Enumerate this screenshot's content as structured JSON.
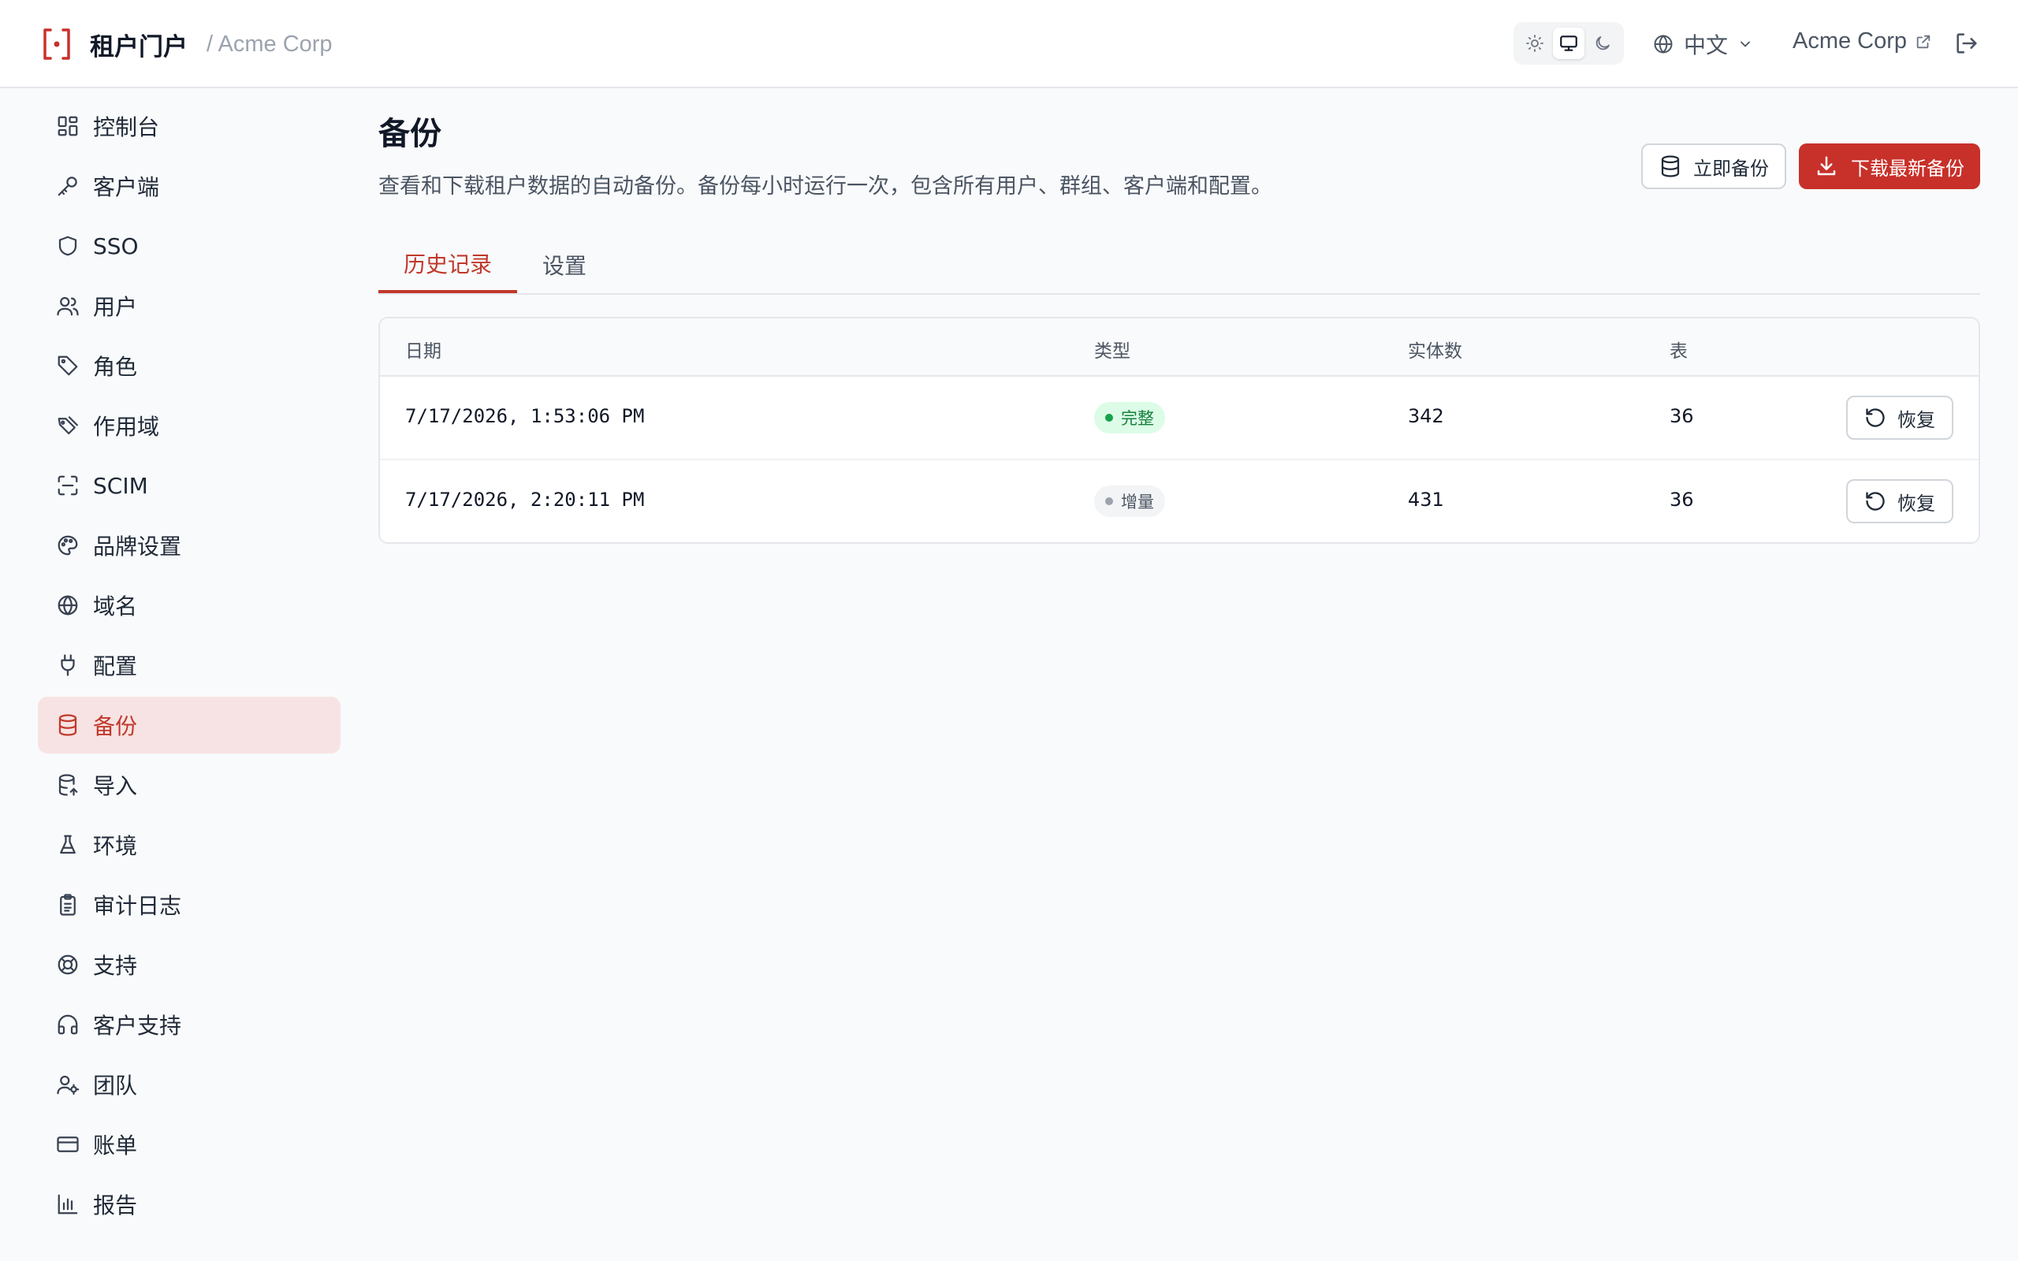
{
  "header": {
    "app_name": "租户门户",
    "tenant_breadcrumb": "/ Acme Corp",
    "language": "中文",
    "tenant_name": "Acme Corp",
    "theme_options": [
      "light",
      "system",
      "dark"
    ],
    "theme_selected": "system"
  },
  "sidebar": {
    "items": [
      {
        "label": "控制台",
        "icon": "dashboard-icon"
      },
      {
        "label": "客户端",
        "icon": "key-icon"
      },
      {
        "label": "SSO",
        "icon": "shield-icon"
      },
      {
        "label": "用户",
        "icon": "users-icon"
      },
      {
        "label": "角色",
        "icon": "tag-icon"
      },
      {
        "label": "作用域",
        "icon": "tags-icon"
      },
      {
        "label": "SCIM",
        "icon": "scan-icon"
      },
      {
        "label": "品牌设置",
        "icon": "palette-icon"
      },
      {
        "label": "域名",
        "icon": "globe-icon"
      },
      {
        "label": "配置",
        "icon": "plug-icon"
      },
      {
        "label": "备份",
        "icon": "database-icon",
        "active": true
      },
      {
        "label": "导入",
        "icon": "database-import-icon"
      },
      {
        "label": "环境",
        "icon": "flask-icon"
      },
      {
        "label": "审计日志",
        "icon": "clipboard-icon"
      },
      {
        "label": "支持",
        "icon": "lifebuoy-icon"
      },
      {
        "label": "客户支持",
        "icon": "headphones-icon"
      },
      {
        "label": "团队",
        "icon": "user-cog-icon"
      },
      {
        "label": "账单",
        "icon": "credit-card-icon"
      },
      {
        "label": "报告",
        "icon": "bar-chart-icon"
      }
    ]
  },
  "main": {
    "title": "备份",
    "description": "查看和下载租户数据的自动备份。备份每小时运行一次，包含所有用户、群组、客户端和配置。",
    "backup_now_label": "立即备份",
    "download_latest_label": "下载最新备份",
    "tabs": [
      {
        "label": "历史记录",
        "active": true
      },
      {
        "label": "设置",
        "active": false
      }
    ],
    "table": {
      "headers": [
        "日期",
        "类型",
        "实体数",
        "表"
      ],
      "rows": [
        {
          "date": "7/17/2026, 1:53:06 PM",
          "type": "完整",
          "entities": "342",
          "tables": "36",
          "action": "恢复"
        },
        {
          "date": "7/17/2026, 2:20:11 PM",
          "type": "增量",
          "entities": "431",
          "tables": "36",
          "action": "恢复"
        }
      ]
    }
  },
  "colors": {
    "accent": "#c8302a",
    "active_nav_bg": "#f7e3e3",
    "badge_full_bg": "#dcfce7",
    "badge_full_text": "#15803d"
  }
}
